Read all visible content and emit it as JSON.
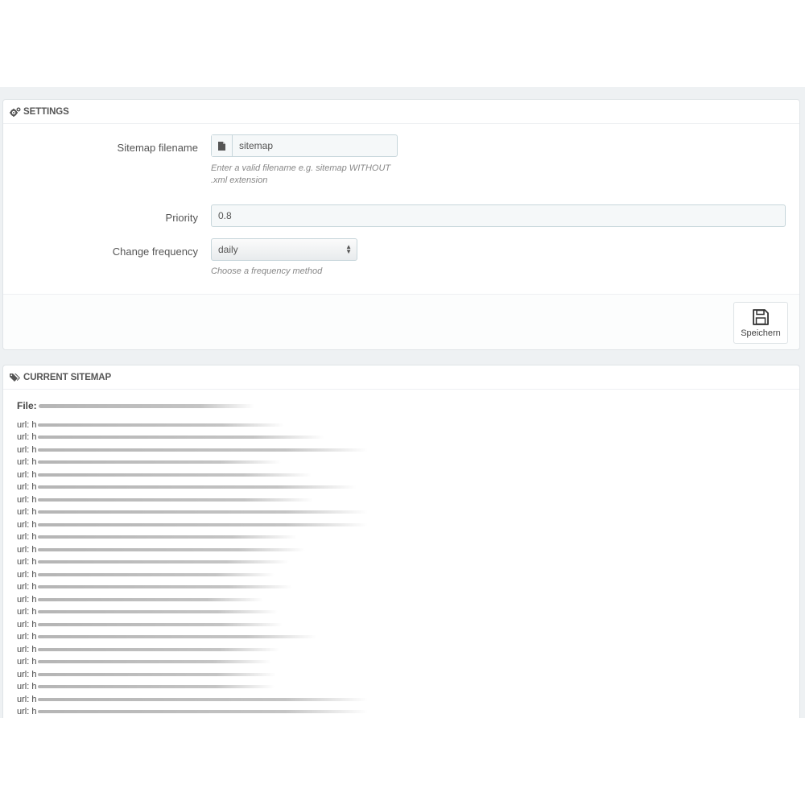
{
  "settings": {
    "title": "SETTINGS",
    "icon": "gears-icon",
    "filename": {
      "label": "Sitemap filename",
      "icon": "file-icon",
      "value": "sitemap",
      "help": "Enter a valid filename e.g. sitemap WITHOUT .xml extension"
    },
    "priority": {
      "label": "Priority",
      "value": "0.8"
    },
    "frequency": {
      "label": "Change frequency",
      "value": "daily",
      "help": "Choose a frequency method"
    },
    "save": {
      "label": "Speichern",
      "icon": "floppy-disk-icon"
    }
  },
  "sitemap": {
    "title": "CURRENT SITEMAP",
    "icon": "tags-icon",
    "file_label": "File:",
    "url_label": "url: h",
    "url_count": 24
  },
  "colors": {
    "page_background": "#eef1f3",
    "panel_border": "#dfe4e7",
    "input_border": "#c7d6db",
    "input_background": "#f5f8f9"
  }
}
